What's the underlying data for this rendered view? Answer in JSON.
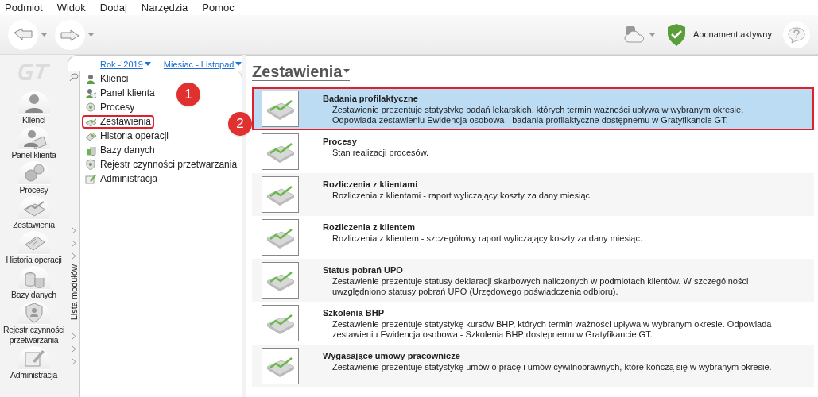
{
  "menu_bar": [
    "Podmiot",
    "Widok",
    "Dodaj",
    "Narzędzia",
    "Pomoc"
  ],
  "toolbar": {
    "subscription": "Abonament aktywny"
  },
  "sidebar": {
    "items": [
      {
        "label": "Klienci"
      },
      {
        "label": "Panel klienta"
      },
      {
        "label": "Procesy"
      },
      {
        "label": "Zestawienia"
      },
      {
        "label": "Historia operacji"
      },
      {
        "label": "Bazy danych"
      },
      {
        "label": "Rejestr czynności przetwarzania"
      },
      {
        "label": "Administracja"
      }
    ]
  },
  "filters": [
    "Rok - 2019",
    "Miesiac - Listopad"
  ],
  "module_list": {
    "title": "Lista modułów",
    "items": [
      {
        "label": "Klienci",
        "highlighted": false
      },
      {
        "label": "Panel klienta",
        "highlighted": false
      },
      {
        "label": "Procesy",
        "highlighted": false
      },
      {
        "label": "Zestawienia",
        "highlighted": true
      },
      {
        "label": "Historia operacji",
        "highlighted": false
      },
      {
        "label": "Bazy danych",
        "highlighted": false
      },
      {
        "label": "Rejestr czynności przetwarzania",
        "highlighted": false
      },
      {
        "label": "Administracja",
        "highlighted": false
      }
    ]
  },
  "callouts": [
    "1",
    "2"
  ],
  "content": {
    "title": "Zestawienia",
    "reports": [
      {
        "title": "Badania profilaktyczne",
        "selected": true,
        "highlighted": true,
        "description": [
          "Zestawienie prezentuje statystykę badań lekarskich, których termin ważności upływa w wybranym okresie.",
          "Odpowiada zestawieniu Ewidencja osobowa - badania profilaktyczne dostępnemu w Gratyfikancie GT."
        ]
      },
      {
        "title": "Procesy",
        "selected": false,
        "highlighted": false,
        "description": [
          "Stan realizacji procesów."
        ]
      },
      {
        "title": "Rozliczenia z klientami",
        "selected": false,
        "highlighted": false,
        "description": [
          "Rozliczenia z klientami - raport wyliczający koszty za dany miesiąc."
        ]
      },
      {
        "title": "Rozliczenia z klientem",
        "selected": false,
        "highlighted": false,
        "description": [
          "Rozliczenia z klientem - szczegółowy raport wyliczający koszty za dany miesiąc."
        ]
      },
      {
        "title": "Status pobrań UPO",
        "selected": false,
        "highlighted": false,
        "description": [
          "Zestawienie prezentuje statusy deklaracji skarbowych naliczonych w podmiotach klientów. W szczególności",
          "uwzględniono statusy pobrań UPO (Urzędowego poświadczenia odbioru)."
        ]
      },
      {
        "title": "Szkolenia BHP",
        "selected": false,
        "highlighted": false,
        "description": [
          "Zestawienie prezentuje statystykę kursów BHP, których termin ważności upływa w wybranym okresie. Odpowiada",
          "zestawieniu Ewidencja osobowa - Szkolenia BHP dostępnemu w Gratyfikancie GT."
        ]
      },
      {
        "title": "Wygasające umowy pracownicze",
        "selected": false,
        "highlighted": false,
        "description": [
          "Zestawienie prezentuje statystykę umów o pracę i umów cywilnoprawnych, które kończą się w wybranym okresie."
        ]
      }
    ]
  }
}
